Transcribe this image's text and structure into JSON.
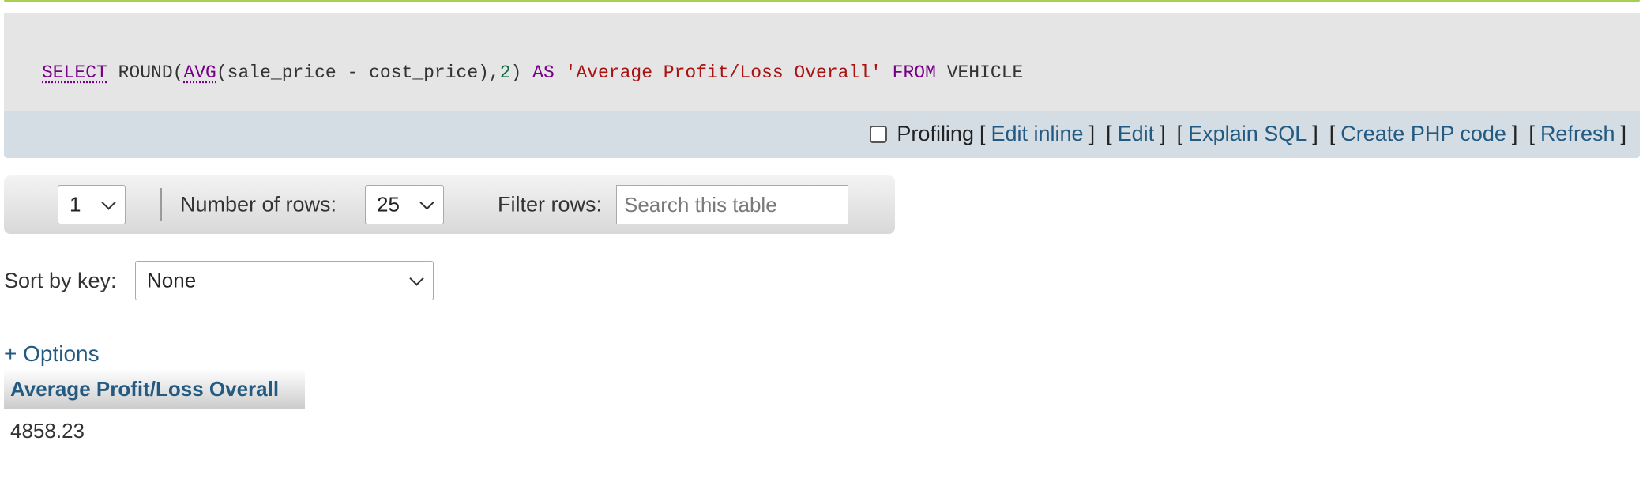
{
  "sql": {
    "select_kw": "SELECT",
    "round_fn": " ROUND(",
    "avg_fn": "AVG",
    "args": "(sale_price - cost_price),",
    "precision": "2",
    "close": ") ",
    "as_kw": "AS",
    "alias": "'Average Profit/Loss Overall'",
    "from_kw": "FROM",
    "table": "VEHICLE"
  },
  "sql_toolbar": {
    "profiling_label": "Profiling",
    "links": [
      "Edit inline",
      "Edit",
      "Explain SQL",
      "Create PHP code",
      "Refresh"
    ],
    "bracket_open": "[",
    "bracket_close": "]"
  },
  "navigation": {
    "page_value": "1",
    "rows_label": "Number of rows:",
    "rows_value": "25",
    "filter_label": "Filter rows:",
    "filter_placeholder": "Search this table"
  },
  "sort": {
    "label": "Sort by key:",
    "value": "None"
  },
  "options_link": "+ Options",
  "results": {
    "columns": [
      "Average Profit/Loss Overall"
    ],
    "rows": [
      [
        "4858.23"
      ]
    ]
  }
}
